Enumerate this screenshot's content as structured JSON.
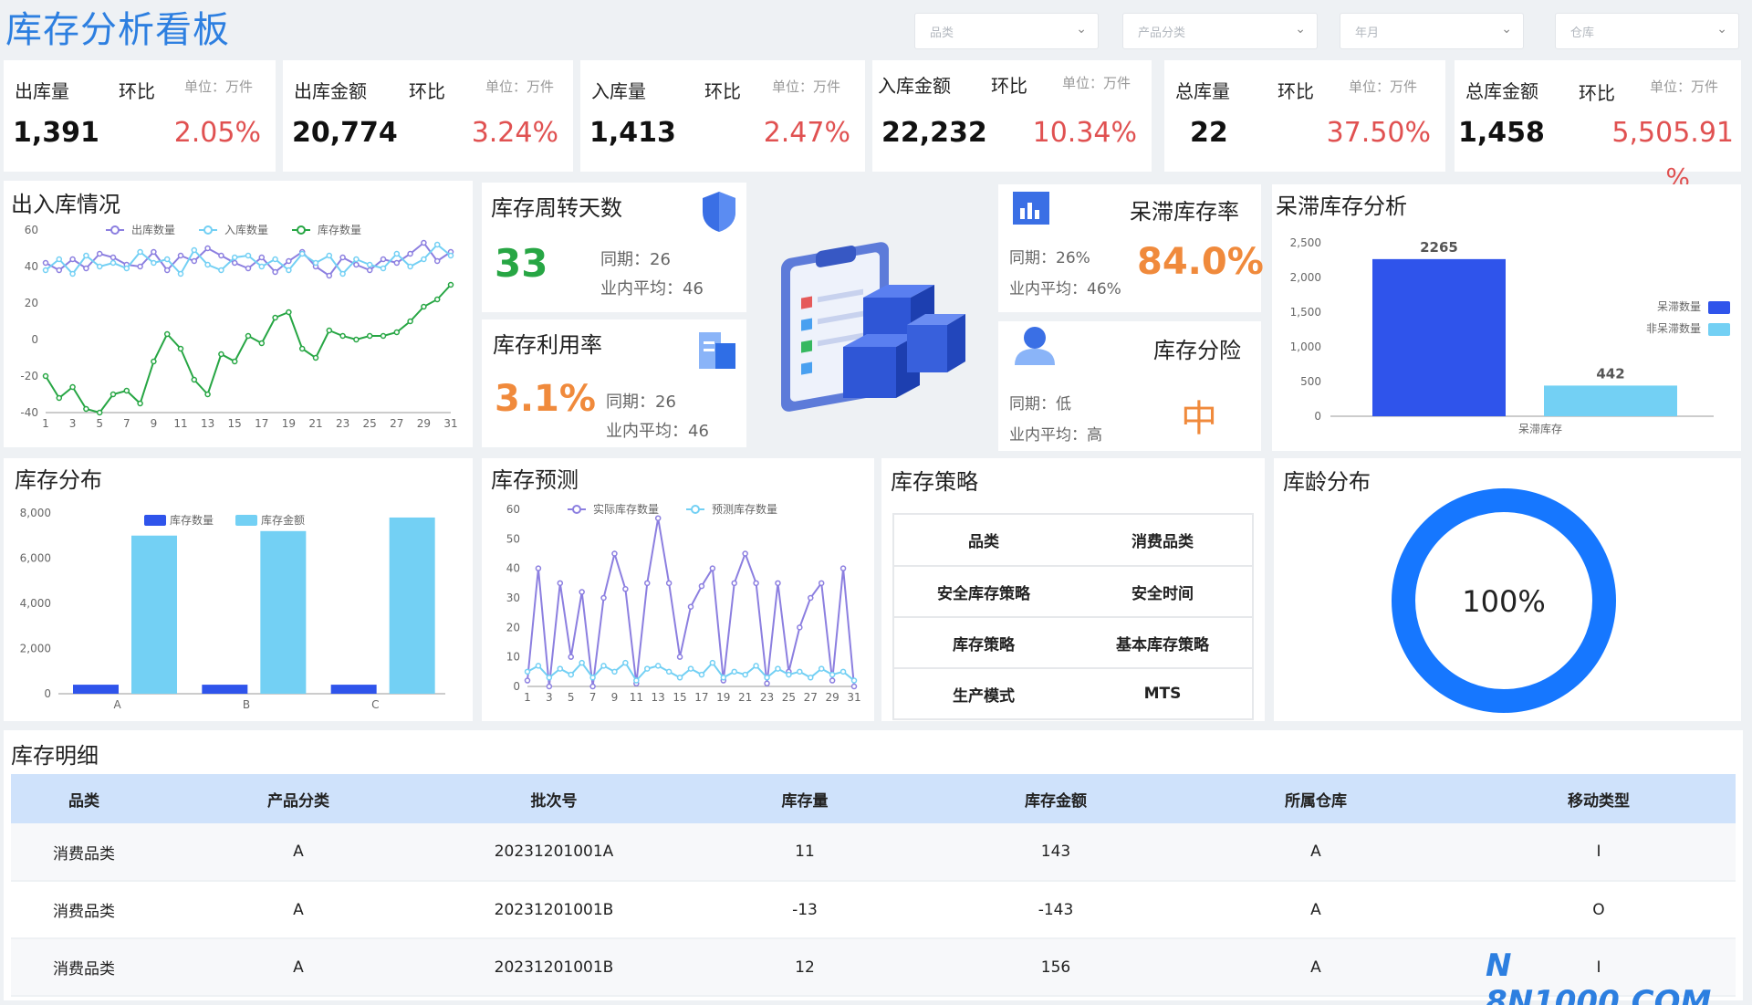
{
  "header": {
    "title": "库存分析看板",
    "filters": [
      "品类",
      "产品分类",
      "年月",
      "仓库"
    ]
  },
  "kpis": [
    {
      "label": "出库量",
      "ratio_label": "环比",
      "unit": "单位：万件",
      "value": "1,391",
      "pct": "2.05%"
    },
    {
      "label": "出库金额",
      "ratio_label": "环比",
      "unit": "单位：万件",
      "value": "20,774",
      "pct": "3.24%"
    },
    {
      "label": "入库量",
      "ratio_label": "环比",
      "unit": "单位：万件",
      "value": "1,413",
      "pct": "2.47%"
    },
    {
      "label": "入库金额",
      "ratio_label": "环比",
      "unit": "单位：万件",
      "value": "22,232",
      "pct": "10.34%"
    },
    {
      "label": "总库量",
      "ratio_label": "环比",
      "unit": "单位：万件",
      "value": "22",
      "pct": "37.50%"
    },
    {
      "label": "总库金额",
      "ratio_label": "环比",
      "unit": "单位：万件",
      "value": "1,458",
      "pct": "5,505.91",
      "pct2": "%"
    }
  ],
  "inout": {
    "title": "出入库情况"
  },
  "turnover": {
    "title": "库存周转天数",
    "value": "33",
    "same": "同期：26",
    "avg": "业内平均：46"
  },
  "util": {
    "title": "库存利用率",
    "value": "3.1%",
    "same": "同期：26",
    "avg": "业内平均：46"
  },
  "stagnant_rate": {
    "title": "呆滞库存率",
    "value": "84.0%",
    "same": "同期：26%",
    "avg": "业内平均：46%"
  },
  "risk": {
    "title": "库存分险",
    "value": "中",
    "same": "同期：低",
    "avg": "业内平均：高"
  },
  "stagnant": {
    "title": "呆滞库存分析"
  },
  "distribution": {
    "title": "库存分布"
  },
  "forecast": {
    "title": "库存预测"
  },
  "strategy": {
    "title": "库存策略",
    "rows": [
      [
        "品类",
        "消费品类"
      ],
      [
        "安全库存策略",
        "安全时间"
      ],
      [
        "库存策略",
        "基本库存策略"
      ],
      [
        "生产模式",
        "MTS"
      ]
    ]
  },
  "age": {
    "title": "库龄分布",
    "value": "100%"
  },
  "detail": {
    "title": "库存明细",
    "headers": [
      "品类",
      "产品分类",
      "批次号",
      "库存量",
      "库存金额",
      "所属仓库",
      "移动类型"
    ],
    "rows": [
      [
        "消费品类",
        "A",
        "20231201001A",
        "11",
        "143",
        "A",
        "I"
      ],
      [
        "消费品类",
        "A",
        "20231201001B",
        "-13",
        "-143",
        "A",
        "O"
      ],
      [
        "消费品类",
        "A",
        "20231201001B",
        "12",
        "156",
        "A",
        "I"
      ]
    ]
  },
  "watermark": "N 8N1000.COM",
  "colors": {
    "accent": "#2d7fe0",
    "red": "#e05151",
    "orange": "#f08a3c",
    "green": "#27a644",
    "dark_blue": "#2f54eb",
    "light_blue": "#73d0f4",
    "purple": "#8c7fe0"
  },
  "chart_data": [
    {
      "type": "line",
      "title": "出入库情况",
      "x": [
        1,
        2,
        3,
        4,
        5,
        6,
        7,
        8,
        9,
        10,
        11,
        12,
        13,
        14,
        15,
        16,
        17,
        18,
        19,
        20,
        21,
        22,
        23,
        24,
        25,
        26,
        27,
        28,
        29,
        30,
        31
      ],
      "ylim": [
        -40,
        60
      ],
      "series": [
        {
          "name": "出库数量",
          "values": [
            42,
            38,
            44,
            39,
            47,
            45,
            41,
            40,
            48,
            38,
            46,
            43,
            50,
            46,
            42,
            39,
            45,
            37,
            43,
            48,
            40,
            35,
            45,
            41,
            38,
            44,
            42,
            47,
            53,
            43,
            48
          ]
        },
        {
          "name": "入库数量",
          "values": [
            38,
            44,
            36,
            46,
            40,
            42,
            39,
            48,
            42,
            44,
            36,
            49,
            41,
            38,
            45,
            46,
            40,
            44,
            38,
            47,
            42,
            46,
            36,
            44,
            41,
            39,
            47,
            40,
            44,
            52,
            46
          ]
        },
        {
          "name": "库存数量",
          "values": [
            -20,
            -32,
            -26,
            -38,
            -40,
            -30,
            -28,
            -35,
            -12,
            3,
            -5,
            -22,
            -30,
            -8,
            -12,
            2,
            -2,
            12,
            15,
            -5,
            -10,
            5,
            2,
            0,
            2,
            2,
            4,
            10,
            18,
            22,
            30
          ]
        }
      ]
    },
    {
      "type": "bar",
      "title": "呆滞库存分析",
      "categories": [
        "呆滞库存"
      ],
      "ylim": [
        0,
        2500
      ],
      "series": [
        {
          "name": "呆滞数量",
          "values": [
            2265
          ]
        },
        {
          "name": "非呆滞数量",
          "values": [
            442
          ]
        }
      ]
    },
    {
      "type": "bar",
      "title": "库存分布",
      "categories": [
        "A",
        "B",
        "C"
      ],
      "ylim": [
        0,
        8000
      ],
      "series": [
        {
          "name": "库存数量",
          "values": [
            400,
            400,
            400
          ]
        },
        {
          "name": "库存金额",
          "values": [
            7000,
            7200,
            7800
          ]
        }
      ]
    },
    {
      "type": "line",
      "title": "库存预测",
      "x": [
        1,
        2,
        3,
        4,
        5,
        6,
        7,
        8,
        9,
        10,
        11,
        12,
        13,
        14,
        15,
        16,
        17,
        18,
        19,
        20,
        21,
        22,
        23,
        24,
        25,
        26,
        27,
        28,
        29,
        30,
        31
      ],
      "ylim": [
        0,
        60
      ],
      "series": [
        {
          "name": "实际库存数量",
          "values": [
            2,
            40,
            0,
            35,
            10,
            32,
            0,
            30,
            45,
            33,
            1,
            35,
            57,
            35,
            10,
            27,
            34,
            40,
            2,
            35,
            45,
            35,
            1,
            35,
            5,
            20,
            30,
            35,
            2,
            40,
            0
          ]
        },
        {
          "name": "预测库存数量",
          "values": [
            5,
            7,
            3,
            6,
            4,
            8,
            3,
            7,
            5,
            8,
            2,
            6,
            7,
            5,
            3,
            6,
            4,
            8,
            3,
            5,
            4,
            7,
            3,
            6,
            4,
            5,
            3,
            6,
            4,
            5,
            2
          ]
        }
      ]
    },
    {
      "type": "pie",
      "title": "库龄分布",
      "values": [
        100
      ]
    }
  ]
}
